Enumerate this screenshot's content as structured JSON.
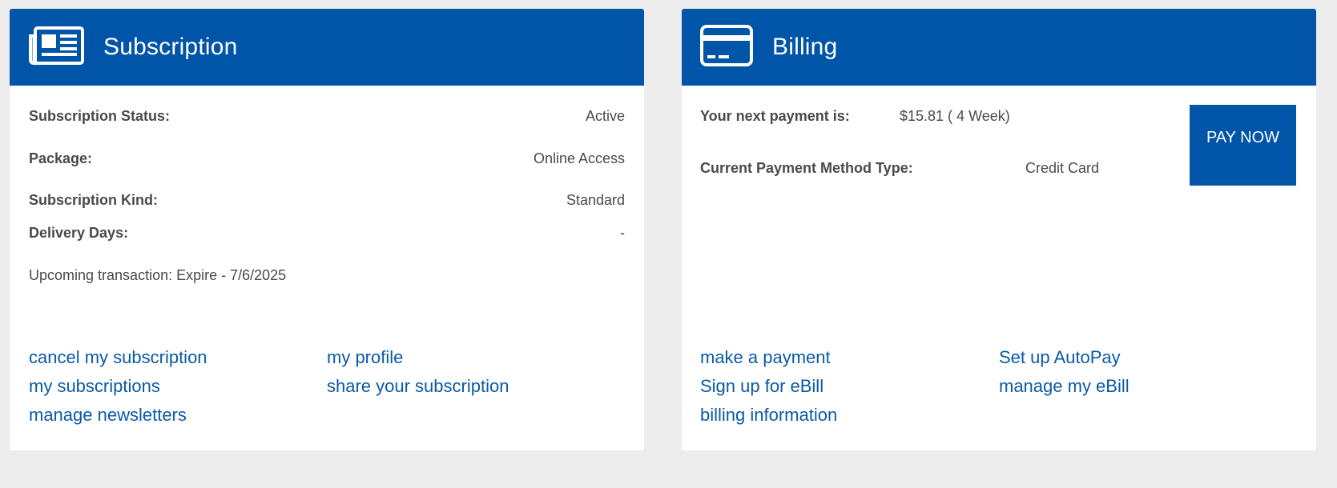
{
  "subscription": {
    "title": "Subscription",
    "icon": "newspaper-icon",
    "fields": [
      {
        "label": "Subscription Status:",
        "value": "Active"
      },
      {
        "label": "Package:",
        "value": "Online Access"
      },
      {
        "label": "Subscription Kind:",
        "value": "Standard"
      },
      {
        "label": "Delivery Days:",
        "value": "-"
      }
    ],
    "upcoming": "Upcoming transaction: Expire - 7/6/2025",
    "links": [
      "cancel my subscription",
      "my profile",
      "my subscriptions",
      "share your subscription",
      "manage newsletters"
    ]
  },
  "billing": {
    "title": "Billing",
    "icon": "credit-card-icon",
    "next_payment_label": "Your next payment is:",
    "next_payment_value": "$15.81 ( 4 Week)",
    "method_label": "Current Payment Method Type:",
    "method_value": "Credit Card",
    "pay_button": "PAY NOW",
    "links": [
      "make a payment",
      "Set up AutoPay",
      "Sign up for eBill",
      "manage my eBill",
      "billing information"
    ]
  },
  "colors": {
    "header": "#0055a8",
    "link": "#0a5aa8",
    "background": "#ececec"
  }
}
